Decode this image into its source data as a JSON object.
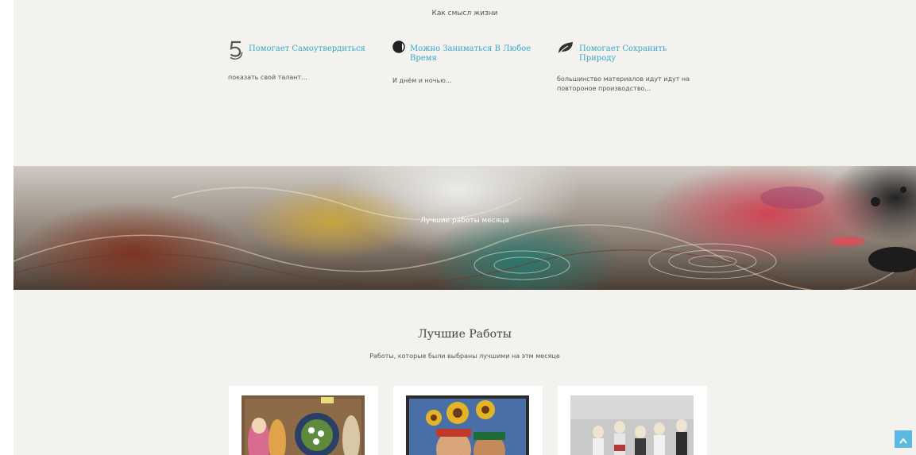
{
  "tagline": "Как смысл жизни",
  "features": [
    {
      "title": "Помогает Самоутвердиться",
      "description": "показать свой талант..."
    },
    {
      "title": "Можно Заниматься В Любое Время",
      "description": "И днём и ночью..."
    },
    {
      "title": "Помогает Сохранить Природу",
      "description": "большинство материалов идут идут на повтороное производство..."
    }
  ],
  "banner": {
    "text": "Лучшие работы месяца"
  },
  "best_works": {
    "title": "Лучшие Работы",
    "subtitle": "Работы, которые были выбраны лучшими на этм месяце"
  },
  "colors": {
    "accent": "#3aa6c6",
    "background": "#f3f2ef",
    "scroll_button": "#5bb8e0"
  }
}
